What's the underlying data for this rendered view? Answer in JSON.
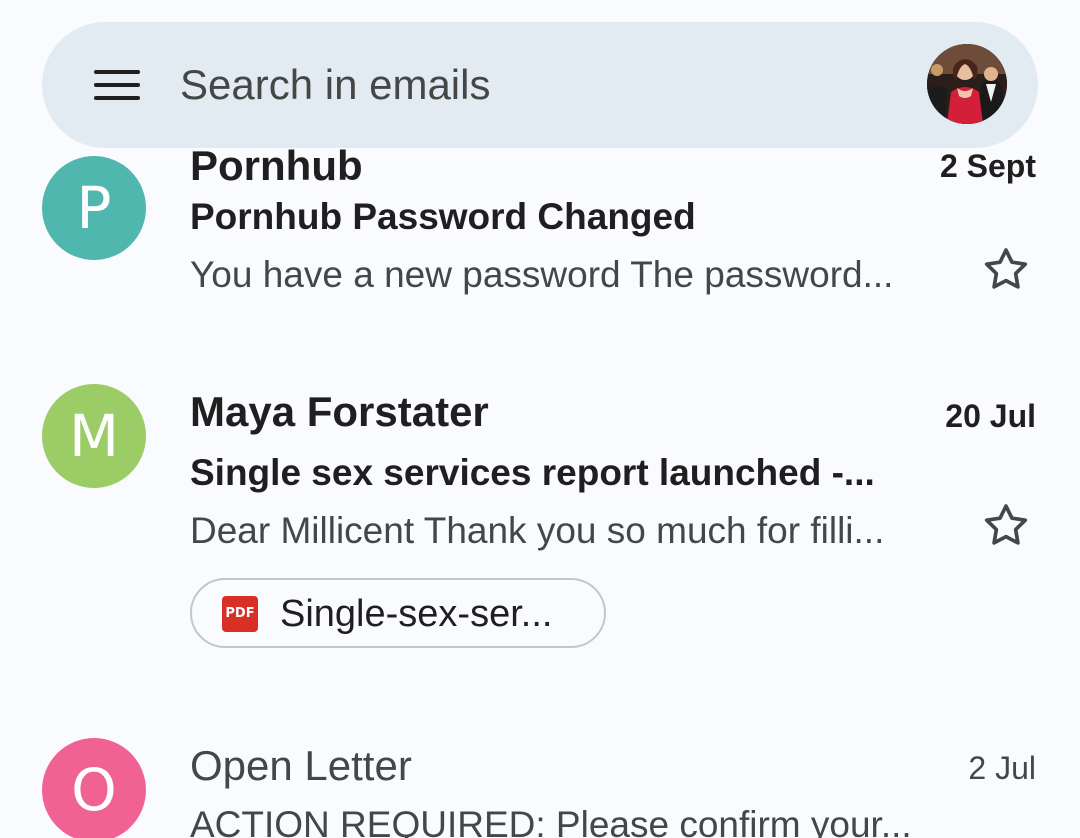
{
  "search": {
    "placeholder": "Search in emails",
    "menu_icon": "hamburger-menu-icon",
    "account_avatar": "profile-photo"
  },
  "emails": [
    {
      "avatar_letter": "P",
      "avatar_color": "#4fb7ae",
      "sender": "Pornhub",
      "date": "2 Sept",
      "subject": "Pornhub Password Changed",
      "snippet": "You have a new password The password...",
      "unread": true,
      "starred": false
    },
    {
      "avatar_letter": "M",
      "avatar_color": "#9ccc65",
      "sender": "Maya Forstater",
      "date": "20 Jul",
      "subject": "Single sex services report launched -...",
      "snippet": "Dear Millicent Thank you so much for filli...",
      "unread": true,
      "starred": false,
      "attachment": {
        "type": "PDF",
        "name": "Single-sex-ser..."
      }
    },
    {
      "avatar_letter": "O",
      "avatar_color": "#f06292",
      "sender": "Open Letter",
      "date": "2 Jul",
      "subject": "ACTION REQUIRED: Please confirm your...",
      "unread": false,
      "starred": false
    }
  ],
  "colors": {
    "background": "#fafbfe",
    "search_bar": "#e1ebf1",
    "text_primary": "#1f1f1f",
    "text_secondary": "#444746",
    "pdf_red": "#d93025"
  }
}
